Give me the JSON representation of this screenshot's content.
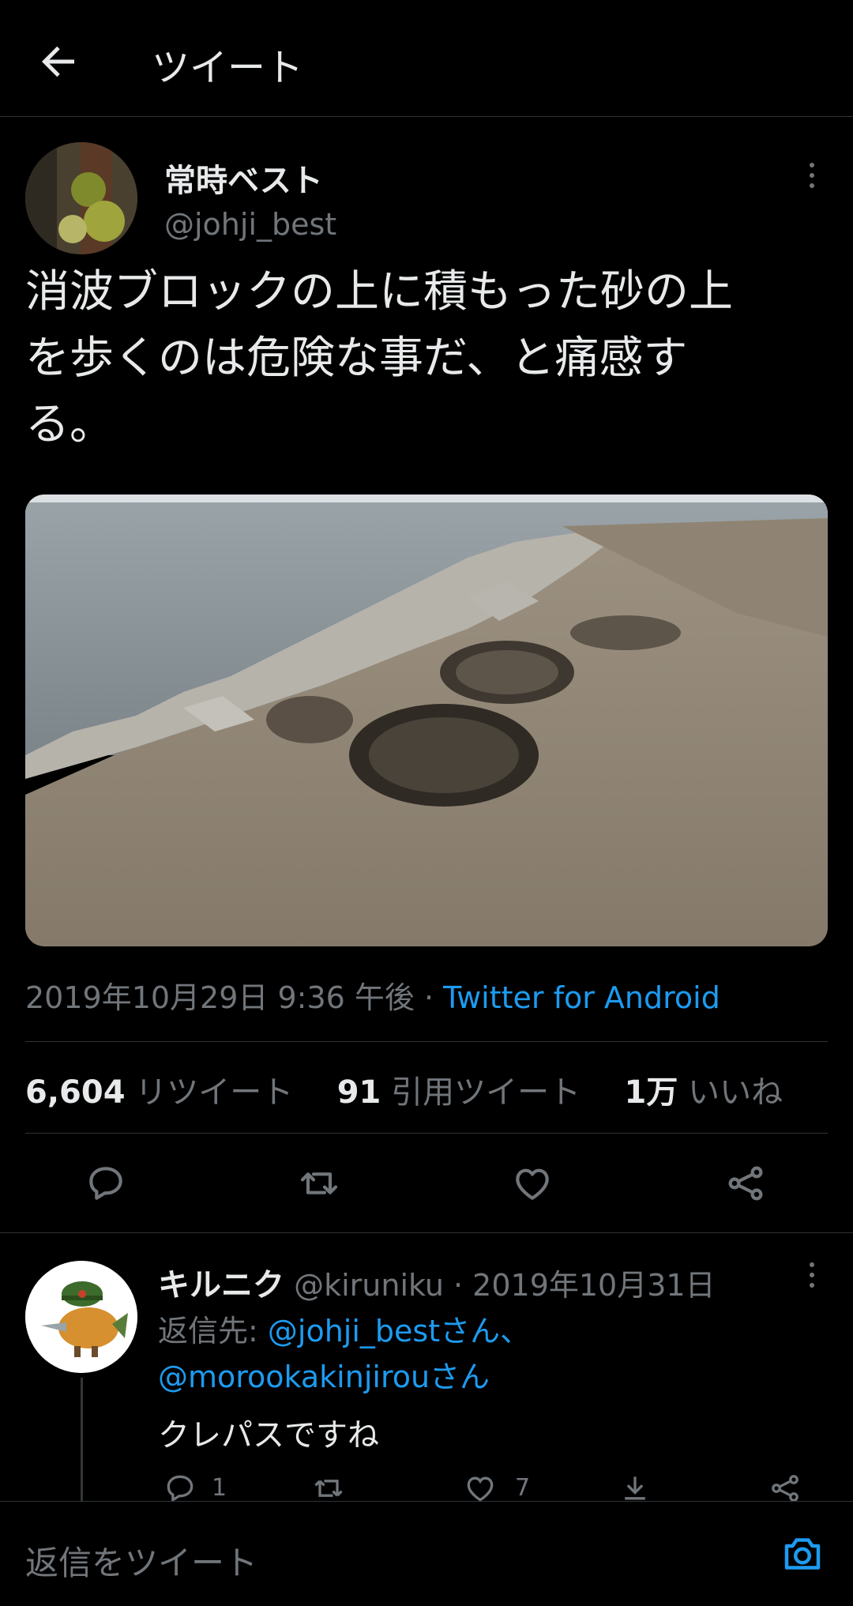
{
  "header": {
    "title": "ツイート",
    "back_icon": "arrow-left-icon"
  },
  "tweet": {
    "author_name": "常時ベスト",
    "author_handle": "@johji_best",
    "text_line1": "消波ブロックの上に積もった砂の上",
    "text_line2": "を歩くのは危険な事だ、と痛感す",
    "text_line3": "る。",
    "timestamp": "2019年10月29日 9:36 午後 · ",
    "source": "Twitter for Android",
    "retweets_count": "6,604",
    "retweets_label": "リツイート",
    "quotes_count": "91",
    "quotes_label": "引用ツイート",
    "likes_count": "1万",
    "likes_label": "いいね"
  },
  "reply": {
    "author_name": "キルニク",
    "author_handle": "@kiruniku",
    "date": " · 2019年10月31日",
    "replying_prefix": "返信先: ",
    "replying_to_1": "@johji_bestさん、",
    "replying_to_2": "@morookakinjirouさん",
    "text": "クレパスですね",
    "reply_count": "1",
    "like_count": "7"
  },
  "compose": {
    "placeholder": "返信をツイート",
    "camera_icon": "camera-icon"
  },
  "colors": {
    "accent": "#1d9bf0",
    "background": "#000000",
    "secondary_text": "#71767b"
  }
}
